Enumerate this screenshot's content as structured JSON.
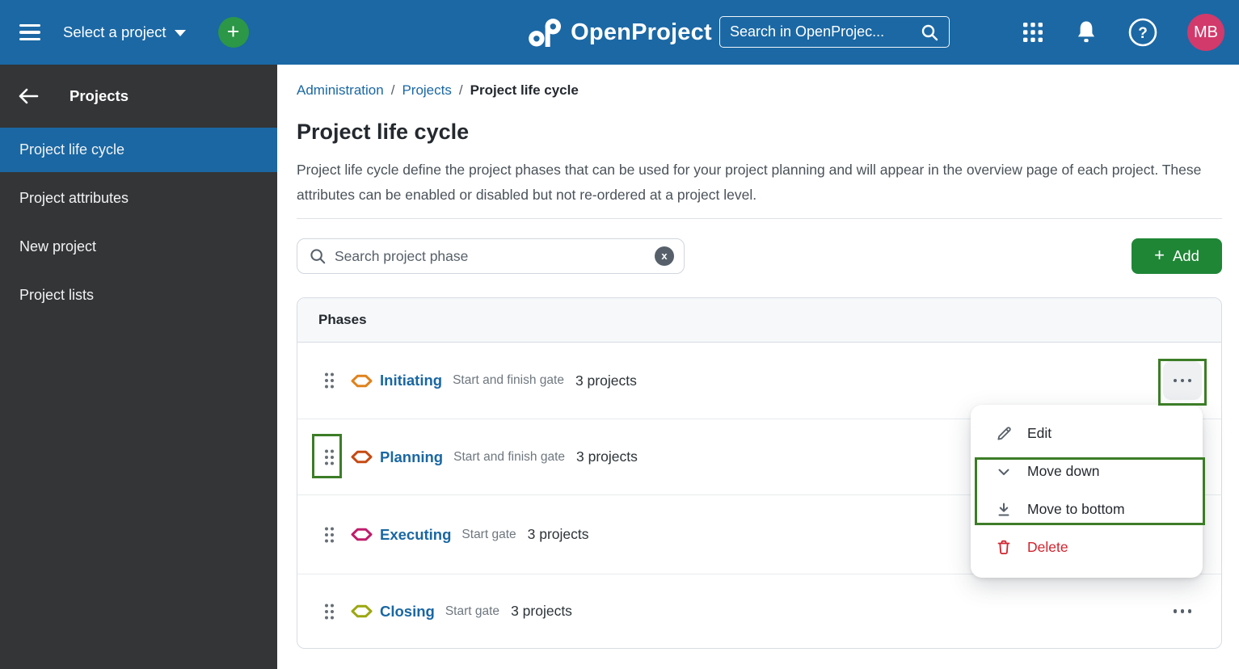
{
  "header": {
    "select_project_label": "Select a project",
    "logo_text": "OpenProject",
    "search_placeholder": "Search in OpenProjec...",
    "avatar_initials": "MB"
  },
  "sidebar": {
    "title": "Projects",
    "items": [
      {
        "label": "Project life cycle",
        "active": true
      },
      {
        "label": "Project attributes",
        "active": false
      },
      {
        "label": "New project",
        "active": false
      },
      {
        "label": "Project lists",
        "active": false
      }
    ]
  },
  "breadcrumb": {
    "items": [
      "Administration",
      "Projects"
    ],
    "separator": "/",
    "current": "Project life cycle"
  },
  "page": {
    "title": "Project life cycle",
    "description": "Project life cycle define the project phases that can be used for your project planning and will appear in the overview page of each project. These attributes can be enabled or disabled but not re-ordered at a project level."
  },
  "toolbar": {
    "search_placeholder": "Search project phase",
    "clear_label": "x",
    "add_plus": "+",
    "add_label": "Add"
  },
  "phases": {
    "header": "Phases",
    "rows": [
      {
        "name": "Initiating",
        "gate": "Start and finish gate",
        "projects": "3 projects",
        "color": "#e0821c"
      },
      {
        "name": "Planning",
        "gate": "Start and finish gate",
        "projects": "3 projects",
        "color": "#c74a12"
      },
      {
        "name": "Executing",
        "gate": "Start gate",
        "projects": "3 projects",
        "color": "#c01d6c"
      },
      {
        "name": "Closing",
        "gate": "Start gate",
        "projects": "3 projects",
        "color": "#9ba70f"
      }
    ]
  },
  "context_menu": {
    "items": [
      {
        "label": "Edit",
        "icon": "pencil-icon",
        "danger": false
      },
      {
        "label": "Move down",
        "icon": "chevron-down-icon",
        "danger": false
      },
      {
        "label": "Move to bottom",
        "icon": "move-to-bottom-icon",
        "danger": false
      },
      {
        "label": "Delete",
        "icon": "trash-icon",
        "danger": true
      }
    ]
  },
  "colors": {
    "header_blue": "#1b68a4",
    "accent_blue": "#1a67a3",
    "sidebar_dark": "#333537",
    "add_green": "#1f8636",
    "annotation_green": "#3c7d27",
    "delete_red": "#d1242f",
    "avatar_pink": "#d23a6b"
  }
}
